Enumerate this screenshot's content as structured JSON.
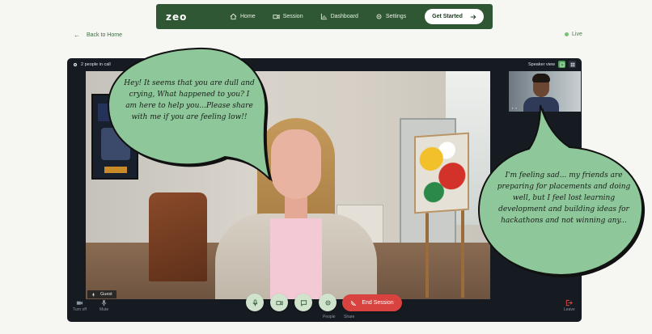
{
  "nav": {
    "logo": "zeo",
    "items": [
      {
        "label": "Home",
        "icon": "home-icon"
      },
      {
        "label": "Session",
        "icon": "video-icon"
      },
      {
        "label": "Dashboard",
        "icon": "chart-icon"
      },
      {
        "label": "Settings",
        "icon": "gear-icon"
      }
    ],
    "cta": "Get Started"
  },
  "back": {
    "label": "Back to Home"
  },
  "status": {
    "label": "Live",
    "color": "#7bbf77"
  },
  "call": {
    "people_count": "2 people in call",
    "view_label": "Speaker view",
    "guest_label": "Guest"
  },
  "controls": {
    "turn_off": "Turn off",
    "mute": "Mute",
    "people": "People",
    "share": "Share",
    "end_session": "End Session",
    "leave": "Leave"
  },
  "bubbles": {
    "ai_message": "Hey! It seems that you are dull and crying, What happened to you? I am here to help you...Please share with me if you are feeling low!!",
    "user_message": "I'm feeling sad... my friends are preparing for placements and doing well, but I feel lost learning development and building ideas for hackathons and not winning any..."
  },
  "colors": {
    "brand": "#2f5733",
    "bubble": "#8ec79a",
    "end": "#d8433f"
  }
}
